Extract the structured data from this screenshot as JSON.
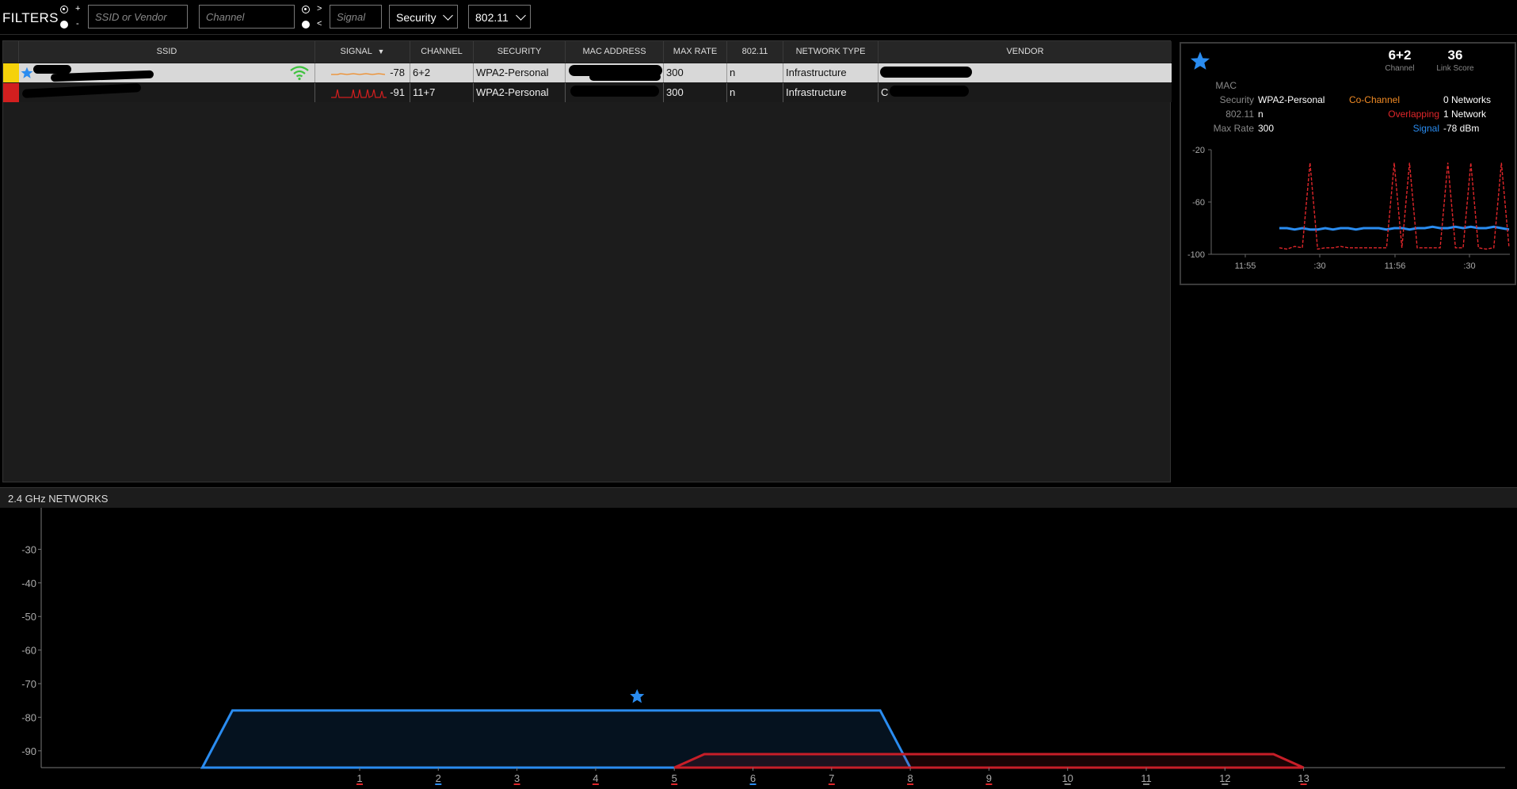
{
  "filters": {
    "label": "FILTERS",
    "plus": "+",
    "minus": "-",
    "gt": ">",
    "lt": "<",
    "ssid_placeholder": "SSID or Vendor",
    "channel_placeholder": "Channel",
    "signal_placeholder": "Signal",
    "security_label": "Security",
    "standard_label": "802.11"
  },
  "table": {
    "headers": [
      "SSID",
      "SIGNAL",
      "CHANNEL",
      "SECURITY",
      "MAC ADDRESS",
      "MAX RATE",
      "802.11",
      "NETWORK TYPE",
      "VENDOR"
    ],
    "rows": [
      {
        "color": "#f5d20a",
        "favorite": true,
        "signal": "-78",
        "channel": "6+2",
        "security": "WPA2-Personal",
        "max_rate": "300",
        "standard": "n",
        "network_type": "Infrastructure",
        "vendor": ""
      },
      {
        "color": "#d21f1f",
        "favorite": false,
        "signal": "-91",
        "channel": "11+7",
        "security": "WPA2-Personal",
        "max_rate": "300",
        "standard": "n",
        "network_type": "Infrastructure",
        "vendor": "C"
      }
    ]
  },
  "details": {
    "channel_value": "6+2",
    "channel_caption": "Channel",
    "link_score_value": "36",
    "link_score_caption": "Link Score",
    "mac_label": "MAC",
    "security_label": "Security",
    "security_value": "WPA2-Personal",
    "standard_label": "802.11",
    "standard_value": "n",
    "max_rate_label": "Max Rate",
    "max_rate_value": "300",
    "co_channel_label": "Co-Channel",
    "co_channel_value": "0 Networks",
    "overlapping_label": "Overlapping",
    "overlapping_value": "1 Network",
    "signal_label": "Signal",
    "signal_value": "-78 dBm",
    "colors": {
      "co_channel": "#f08a24",
      "overlapping": "#e0262a",
      "signal": "#2a8cf0"
    }
  },
  "ghz": {
    "title": "2.4 GHz NETWORKS"
  },
  "chart_data": [
    {
      "type": "line",
      "name": "signal-history",
      "ylim": [
        -100,
        -20
      ],
      "yticks": [
        "-20",
        "-60",
        "-100"
      ],
      "xticks": [
        "11:55",
        ":30",
        "11:56",
        ":30"
      ],
      "series": [
        {
          "color": "#2a8cf0",
          "style": "solid",
          "values": [
            -80,
            -80,
            -81,
            -80,
            -81,
            -81,
            -80,
            -81,
            -80,
            -80,
            -81,
            -80,
            -80,
            -80,
            -81,
            -80,
            -80,
            -81,
            -80,
            -80,
            -79,
            -80,
            -80,
            -79,
            -80,
            -79,
            -80,
            -80,
            -79,
            -80,
            -81
          ]
        },
        {
          "color": "#e0262a",
          "style": "dashed",
          "values": [
            -95,
            -96,
            -94,
            -95,
            -30,
            -96,
            -95,
            -95,
            -94,
            -95,
            -95,
            -95,
            -95,
            -95,
            -95,
            -30,
            -95,
            -30,
            -95,
            -95,
            -95,
            -95,
            -30,
            -95,
            -95,
            -30,
            -95,
            -96,
            -95,
            -30,
            -95
          ]
        }
      ]
    },
    {
      "type": "area",
      "name": "2.4ghz-spectrum",
      "ylim": [
        -95,
        -20
      ],
      "yticks": [
        "-30",
        "-40",
        "-50",
        "-60",
        "-70",
        "-80",
        "-90"
      ],
      "xticks": [
        "1",
        "2",
        "3",
        "4",
        "5",
        "6",
        "7",
        "8",
        "9",
        "10",
        "11",
        "12",
        "13"
      ],
      "tick_colors": [
        "#e0262a",
        "#2a8cf0",
        "#e0262a",
        "#e0262a",
        "#e0262a",
        "#2a8cf0",
        "#e0262a",
        "#e0262a",
        "#e0262a",
        "#888888",
        "#888888",
        "#888888",
        "#e0262a"
      ],
      "networks": [
        {
          "color": "#2a8cf0",
          "signal": -78,
          "channel_start": -1.0,
          "channel_end": 8.0,
          "favorite": true
        },
        {
          "color": "#c81e28",
          "signal": -91,
          "channel_start": 5.0,
          "channel_end": 13.0,
          "favorite": false
        }
      ]
    }
  ]
}
